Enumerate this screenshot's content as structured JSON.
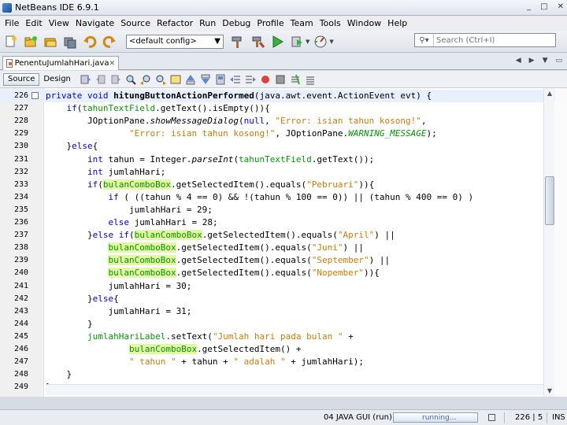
{
  "window": {
    "title": "NetBeans IDE 6.9.1",
    "controls": [
      "_",
      "□",
      "✕"
    ]
  },
  "menu": [
    "File",
    "Edit",
    "View",
    "Navigate",
    "Source",
    "Refactor",
    "Run",
    "Debug",
    "Profile",
    "Team",
    "Tools",
    "Window",
    "Help"
  ],
  "toolbar": {
    "config_value": "<default config>",
    "search_placeholder": "Search (Ctrl+I)"
  },
  "tab": {
    "filename": "PenentuJumlahHari.java"
  },
  "editor_toolbar": {
    "source_label": "Source",
    "design_label": "Design"
  },
  "code_lines": [
    {
      "n": "226",
      "html": "<span class='kw'>private</span> <span class='kw'>void</span> <b>hitungButtonActionPerformed</b>(java.awt.event.ActionEvent evt) {"
    },
    {
      "n": "227",
      "html": "    <span class='kw'>if</span>(<span class='fld'>tahunTextField</span>.getText().isEmpty()){"
    },
    {
      "n": "228",
      "html": "        JOptionPane.<span class='it'>showMessageDialog</span>(<span class='kw'>null</span>, <span class='str'>\"Error: isian tahun kosong!\"</span>,"
    },
    {
      "n": "229",
      "html": "                <span class='str'>\"Error: isian tahun kosong!\"</span>, JOptionPane.<span class='const'>WARNING_MESSAGE</span>);"
    },
    {
      "n": "230",
      "html": "    }<span class='kw'>else</span>{"
    },
    {
      "n": "231",
      "html": "        <span class='kw'>int</span> tahun = Integer.<span class='it'>parseInt</span>(<span class='fld'>tahunTextField</span>.getText());"
    },
    {
      "n": "232",
      "html": "        <span class='kw'>int</span> jumlahHari;"
    },
    {
      "n": "233",
      "html": "        <span class='kw'>if</span>(<span class='hl'>bulanComboBox</span>.getSelectedItem().equals(<span class='str'>\"Pebruari\"</span>)){"
    },
    {
      "n": "234",
      "html": "            <span class='kw'>if</span> ( ((tahun % 4 == 0) && !(tahun % 100 == 0)) || (tahun % 400 == 0) )"
    },
    {
      "n": "235",
      "html": "                jumlahHari = 29;"
    },
    {
      "n": "236",
      "html": "            <span class='kw'>else</span> jumlahHari = 28;"
    },
    {
      "n": "237",
      "html": "        }<span class='kw'>else if</span>(<span class='hl'>bulanComboBox</span>.getSelectedItem().equals(<span class='str'>\"April\"</span>) ||"
    },
    {
      "n": "238",
      "html": "            <span class='hl'>bulanComboBox</span>.getSelectedItem().equals(<span class='str'>\"Juni\"</span>) ||"
    },
    {
      "n": "239",
      "html": "            <span class='hl'>bulanComboBox</span>.getSelectedItem().equals(<span class='str'>\"September\"</span>) ||"
    },
    {
      "n": "240",
      "html": "            <span class='hl'>bulanComboBox</span>.getSelectedItem().equals(<span class='str'>\"Nopember\"</span>)){"
    },
    {
      "n": "241",
      "html": "            jumlahHari = 30;"
    },
    {
      "n": "242",
      "html": "        }<span class='kw'>else</span>{"
    },
    {
      "n": "243",
      "html": "            jumlahHari = 31;"
    },
    {
      "n": "244",
      "html": "        }"
    },
    {
      "n": "245",
      "html": "        <span class='fld'>jumlahHariLabel</span>.setText(<span class='str'>\"Jumlah hari pada bulan \"</span> +"
    },
    {
      "n": "246",
      "html": "                <span class='hl'>bulanComboBox</span>.getSelectedItem() +"
    },
    {
      "n": "247",
      "html": "                <span class='str'>\" tahun \"</span> + tahun + <span class='str'>\" adalah \"</span> + jumlahHari);"
    },
    {
      "n": "248",
      "html": "    }"
    },
    {
      "n": "249",
      "html": "}"
    }
  ],
  "status": {
    "project": "04 JAVA GUI (run)",
    "progress_label": "running...",
    "position": "226 | 5",
    "mode": "INS"
  }
}
